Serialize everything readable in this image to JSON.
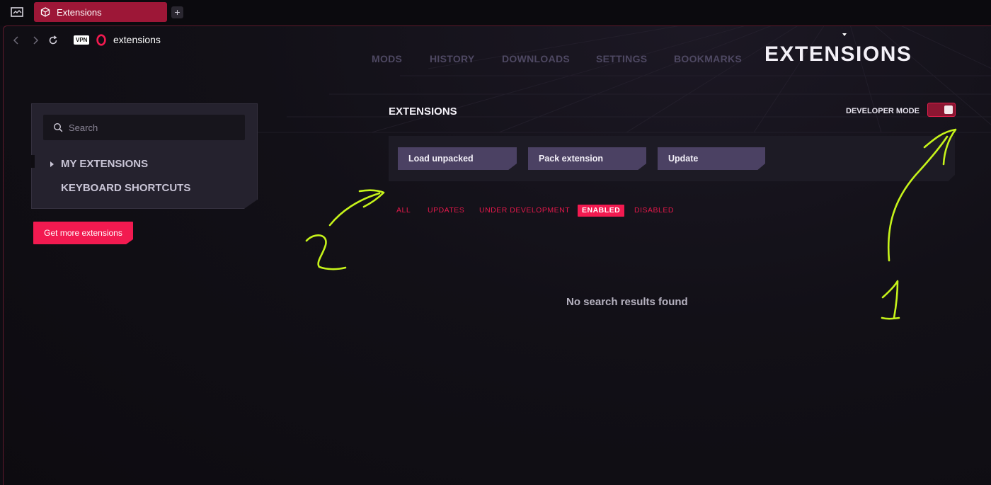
{
  "tab": {
    "label": "Extensions",
    "new_tab_label": "+"
  },
  "address": {
    "vpn_badge": "VPN",
    "url": "extensions"
  },
  "topnav": {
    "items": [
      "MODS",
      "HISTORY",
      "DOWNLOADS",
      "SETTINGS",
      "BOOKMARKS"
    ]
  },
  "page_heading": "EXTENSIONS",
  "sidebar": {
    "search_placeholder": "Search",
    "items": [
      {
        "label": "MY EXTENSIONS"
      },
      {
        "label": "KEYBOARD SHORTCUTS"
      }
    ],
    "get_more_label": "Get more extensions"
  },
  "main": {
    "title": "EXTENSIONS",
    "developer_mode_label": "DEVELOPER MODE",
    "developer_mode_on": true,
    "buttons": [
      "Load unpacked",
      "Pack extension",
      "Update"
    ],
    "filters": [
      "ALL",
      "UPDATES",
      "UNDER DEVELOPMENT",
      "ENABLED",
      "DISABLED"
    ],
    "active_filter": "ENABLED",
    "empty_message": "No search results found"
  },
  "colors": {
    "accent": "#f21a50",
    "tab_active": "#9d1737",
    "button_bg": "#4b4163",
    "annotation": "#c6f31a"
  }
}
